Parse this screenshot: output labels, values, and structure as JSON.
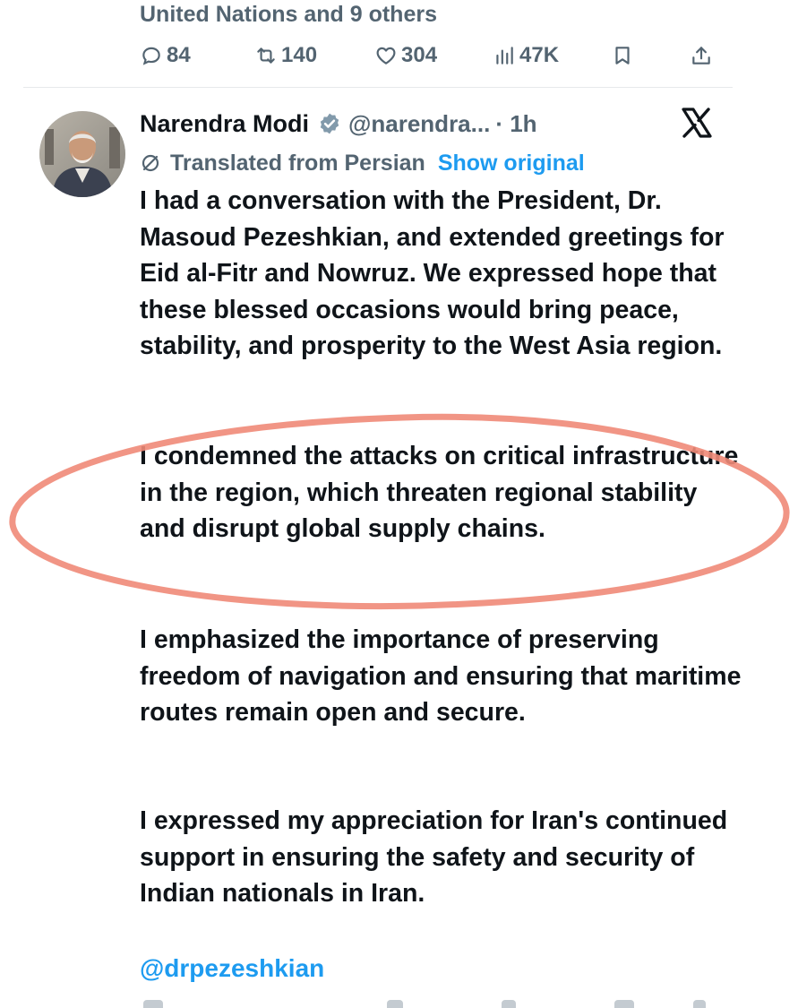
{
  "previous_tweet": {
    "liked_by_text": "United Nations and 9 others",
    "actions": {
      "replies": "84",
      "reposts": "140",
      "likes": "304",
      "views": "47K"
    }
  },
  "tweet": {
    "author_name": "Narendra Modi",
    "handle": "@narendra...",
    "time": "· 1h",
    "translation_label": "Translated from Persian",
    "show_original_label": "Show original",
    "paragraphs": [
      "I had a conversation with the President, Dr. Masoud Pezeshkian, and extended greetings for Eid al-Fitr and Nowruz. We expressed hope that these blessed occasions would bring peace, stability, and prosperity to the West Asia region.",
      "I condemned the attacks on critical infrastructure in the region, which threaten regional stability and disrupt global supply chains.",
      "I emphasized the importance of preserving freedom of navigation and ensuring that maritime routes remain open and secure.",
      "I expressed my appreciation for Iran's continued support in ensuring the safety and security of Indian nationals in Iran."
    ],
    "mention": "@drpezeshkian"
  },
  "colors": {
    "text": "#0f1419",
    "secondary": "#536471",
    "link": "#1d9bf0",
    "highlight_circle": "#f08a78"
  },
  "icons": [
    "reply-icon",
    "repost-icon",
    "like-icon",
    "views-icon",
    "bookmark-icon",
    "share-icon",
    "verified-icon",
    "x-logo-icon",
    "translate-icon"
  ]
}
